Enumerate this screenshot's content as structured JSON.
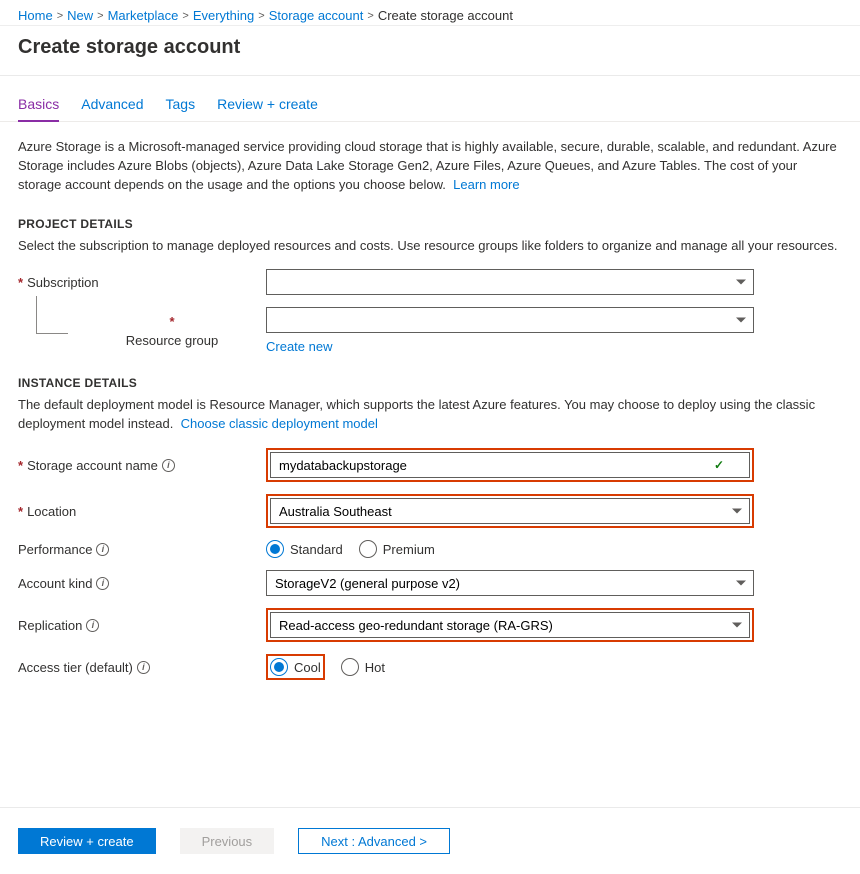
{
  "breadcrumb": {
    "items": [
      "Home",
      "New",
      "Marketplace",
      "Everything",
      "Storage account"
    ],
    "current": "Create storage account"
  },
  "page_title": "Create storage account",
  "tabs": {
    "items": [
      "Basics",
      "Advanced",
      "Tags",
      "Review + create"
    ],
    "active": "Basics"
  },
  "intro": {
    "text": "Azure Storage is a Microsoft-managed service providing cloud storage that is highly available, secure, durable, scalable, and redundant. Azure Storage includes Azure Blobs (objects), Azure Data Lake Storage Gen2, Azure Files, Azure Queues, and Azure Tables. The cost of your storage account depends on the usage and the options you choose below.",
    "learn_more": "Learn more"
  },
  "sections": {
    "project": {
      "header": "PROJECT DETAILS",
      "desc": "Select the subscription to manage deployed resources and costs. Use resource groups like folders to organize and manage all your resources."
    },
    "instance": {
      "header": "INSTANCE DETAILS",
      "desc_prefix": "The default deployment model is Resource Manager, which supports the latest Azure features. You may choose to deploy using the classic deployment model instead.",
      "classic_link": "Choose classic deployment model"
    }
  },
  "fields": {
    "subscription": {
      "label": "Subscription",
      "value": ""
    },
    "resource_group": {
      "label": "Resource group",
      "value": "",
      "create_new": "Create new"
    },
    "storage_name": {
      "label": "Storage account name",
      "value": "mydatabackupstorage"
    },
    "location": {
      "label": "Location",
      "value": "Australia Southeast"
    },
    "performance": {
      "label": "Performance",
      "options": [
        "Standard",
        "Premium"
      ],
      "selected": "Standard"
    },
    "account_kind": {
      "label": "Account kind",
      "value": "StorageV2 (general purpose v2)"
    },
    "replication": {
      "label": "Replication",
      "value": "Read-access geo-redundant storage (RA-GRS)"
    },
    "access_tier": {
      "label": "Access tier (default)",
      "options": [
        "Cool",
        "Hot"
      ],
      "selected": "Cool"
    }
  },
  "footer": {
    "review": "Review + create",
    "previous": "Previous",
    "next": "Next : Advanced >"
  }
}
